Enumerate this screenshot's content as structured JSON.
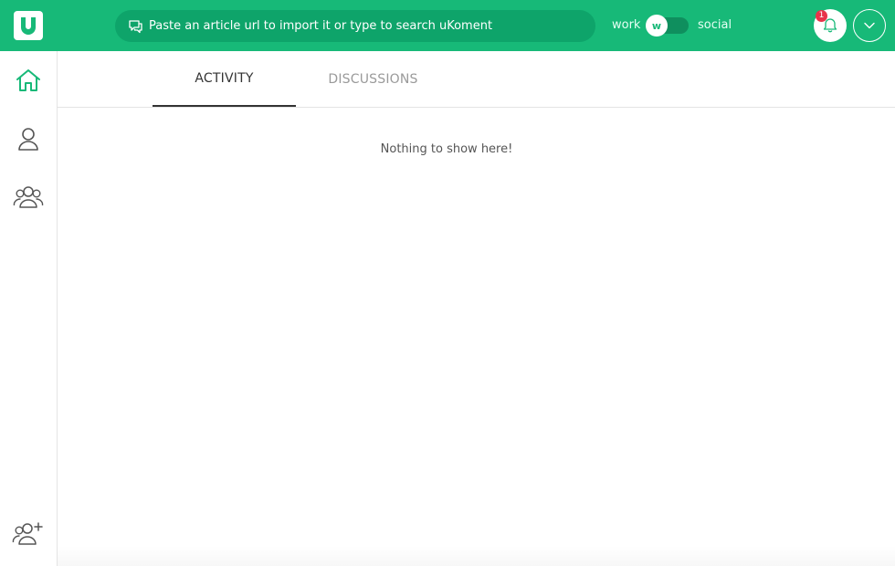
{
  "topbar": {
    "search": {
      "placeholder": "Paste an article url to import it or type to search uKoment"
    },
    "mode": {
      "left_label": "work",
      "right_label": "social",
      "knob_label": "w"
    },
    "notifications": {
      "count": "1"
    }
  },
  "tabs": [
    {
      "label": "ACTIVITY",
      "active": true
    },
    {
      "label": "DISCUSSIONS",
      "active": false
    }
  ],
  "main": {
    "empty_message": "Nothing to show here!"
  },
  "sidebar": {
    "items": [
      {
        "icon": "home-icon",
        "active": true
      },
      {
        "icon": "user-icon",
        "active": false
      },
      {
        "icon": "users-group-icon",
        "active": false
      },
      {
        "icon": "add-users-icon",
        "active": false
      }
    ]
  },
  "colors": {
    "brand": "#17b978",
    "search_bg": "#0ea46a",
    "badge": "#e8334a",
    "text": "#333333",
    "muted": "#9a9a9a"
  }
}
